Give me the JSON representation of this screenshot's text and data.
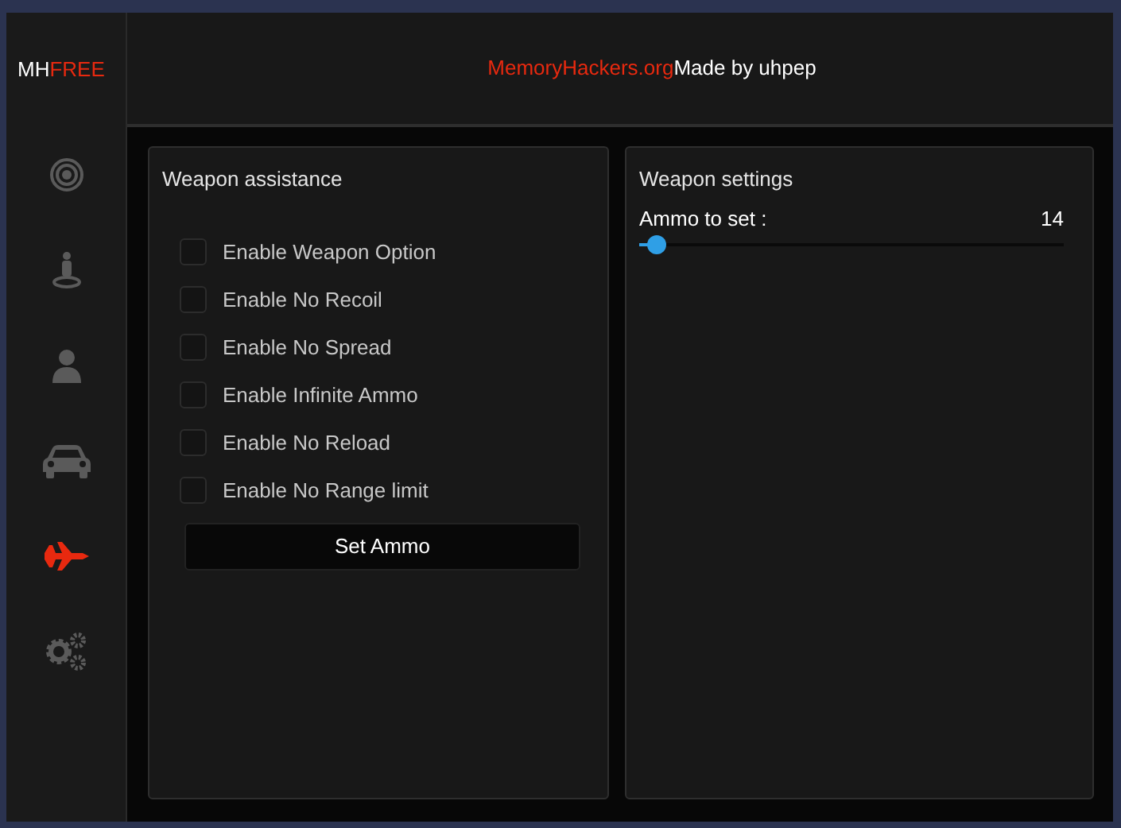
{
  "logo": {
    "prefix": "MH",
    "accent": "FREE"
  },
  "header": {
    "site": "MemoryHackers.org",
    "credit": "Made by uhpep"
  },
  "sidebar": {
    "items": [
      {
        "kind": "target",
        "selected": false
      },
      {
        "kind": "player",
        "selected": false
      },
      {
        "kind": "user",
        "selected": false
      },
      {
        "kind": "car",
        "selected": false
      },
      {
        "kind": "jet",
        "selected": true
      },
      {
        "kind": "gears",
        "selected": false
      }
    ]
  },
  "weapon_assistance": {
    "title": "Weapon assistance",
    "options": [
      {
        "label": "Enable Weapon Option",
        "checked": false
      },
      {
        "label": "Enable No Recoil",
        "checked": false
      },
      {
        "label": "Enable No Spread",
        "checked": false
      },
      {
        "label": "Enable Infinite Ammo",
        "checked": false
      },
      {
        "label": "Enable No Reload",
        "checked": false
      },
      {
        "label": "Enable No Range limit",
        "checked": false
      }
    ],
    "button": "Set Ammo"
  },
  "weapon_settings": {
    "title": "Weapon settings",
    "slider": {
      "label": "Ammo to set :",
      "reading": "14",
      "level": 0.03
    }
  }
}
